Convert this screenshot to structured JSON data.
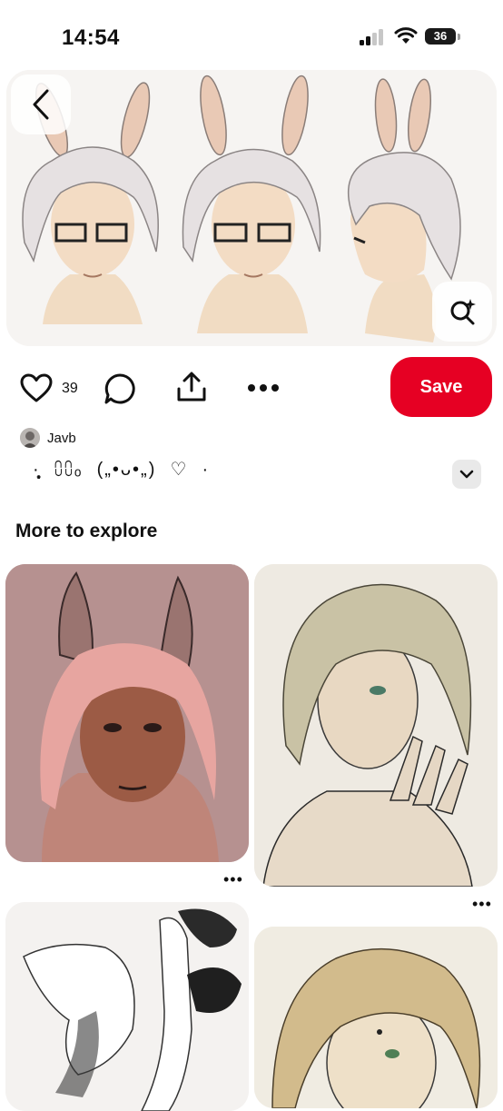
{
  "status_bar": {
    "time": "14:54",
    "battery": "36"
  },
  "hero": {
    "back_icon": "chevron-left-icon",
    "lens_icon": "visual-search-icon"
  },
  "actions": {
    "likes": "39",
    "save_label": "Save"
  },
  "author": {
    "name": "Javb"
  },
  "description": "·̩̩̥͙  ⩇⩇ₒ  („•ᴗ•„)  ♡  ·",
  "section": {
    "title": "More to explore"
  },
  "colors": {
    "save": "#e60023",
    "text": "#111111",
    "chip": "#e9e9e9"
  }
}
